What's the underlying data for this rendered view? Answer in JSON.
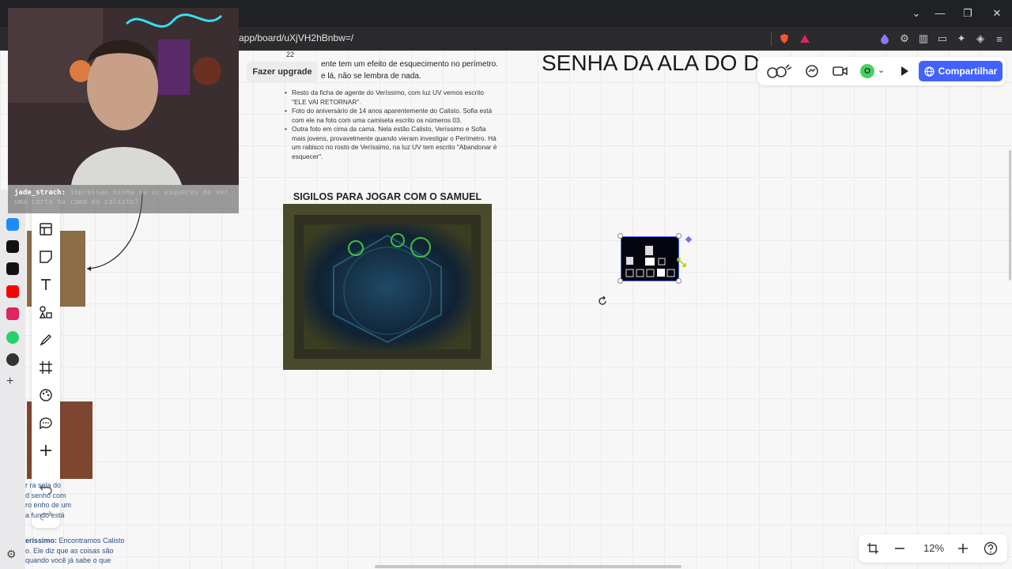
{
  "browser": {
    "url": "app/board/uXjVH2hBnbw=/",
    "controls": {
      "minimize": "—",
      "restore": "❐",
      "close": "✕",
      "dropdown": "⌄"
    }
  },
  "board": {
    "upgrade_label": "Fazer upgrade",
    "page_number": "22",
    "top_text_line1": "ente tem um efeito de esquecimento no perímetro.",
    "top_text_line2": "e lá, não se lembra de nada.",
    "notes": [
      "Resto da ficha de agente do Veríssimo, com luz UV vemos escrito \"ELE VAI RETORNAR\".",
      "Foto do aniversário de 14 anos aparentemente do Calisto. Sofia está com ele na foto com uma camiseta escrito os números 03.",
      "Outra foto em cima da cama. Nela estão Calisto, Veríssimo e Sofia mais jovens, provavelmente quando vieram investigar o Perímetro. Há um rabisco no rosto de Veríssimo, na luz UV tem escrito \"Abandonar é esquecer\"."
    ],
    "big_title": "SENHA DA ALA DO DESASSOMBRADO CALISTO",
    "sigilos_title": "SIGILOS PARA JOGAR COM O SAMUEL",
    "bottom_left_text": [
      "r     ra sala do",
      "d     senho com",
      "ro     enho de um",
      "a        fundo está"
    ],
    "bottom_left_speaker": "eríssimo:",
    "bottom_left_speech": [
      " Encontramos Calisto",
      "o. Ele diz que as coisas são",
      "quando você já sabe o que"
    ]
  },
  "right_panel": {
    "share_label": "Compartilhar",
    "avatar_initial": "O"
  },
  "zoom": {
    "level": "12%"
  },
  "chat": {
    "username": "jade_strach:",
    "message": "impressao minha ou vc esqueceu de ver uma carta na cama do calisto?"
  },
  "colors": {
    "accent": "#4262ff",
    "canvas": "#f7f7f7",
    "chrome": "#202124"
  },
  "icons": {
    "toolbar": [
      "templates-icon",
      "sticky-note-icon",
      "text-icon",
      "shapes-icon",
      "pen-icon",
      "frame-icon",
      "color-palette-icon",
      "comment-icon",
      "plus-icon",
      "undo-icon",
      "redo-icon"
    ],
    "app_strip": [
      "messenger-icon",
      "tiktok-icon",
      "youtube-icon",
      "whatsapp-icon",
      "chatgpt-icon",
      "add-icon",
      "settings-icon"
    ]
  }
}
